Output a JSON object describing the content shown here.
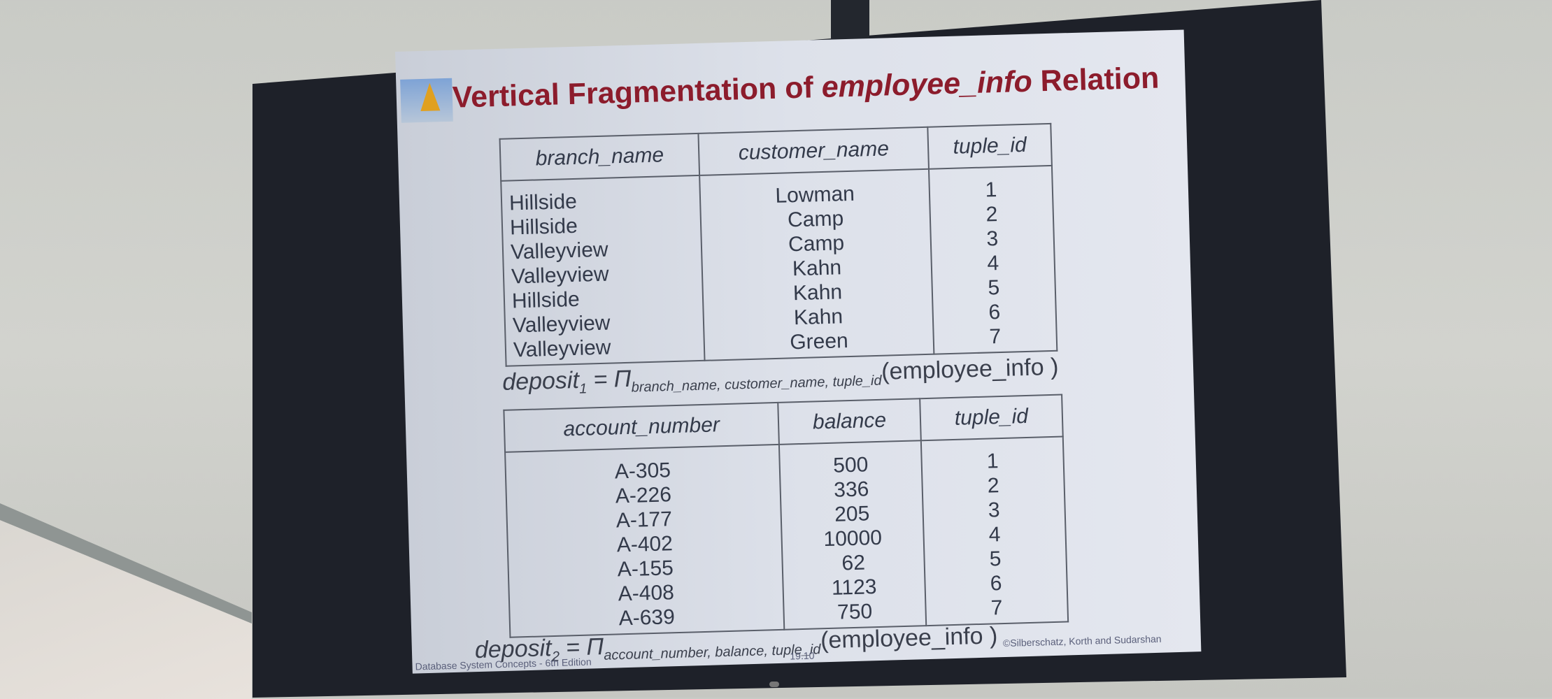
{
  "slide": {
    "title_prefix": "Vertical Fragmentation of ",
    "title_italic": "employee_info",
    "title_suffix": " Relation",
    "table1": {
      "headers": [
        "branch_name",
        "customer_name",
        "tuple_id"
      ],
      "rows": [
        [
          "Hillside",
          "Lowman",
          "1"
        ],
        [
          "Hillside",
          "Camp",
          "2"
        ],
        [
          "Valleyview",
          "Camp",
          "3"
        ],
        [
          "Valleyview",
          "Kahn",
          "4"
        ],
        [
          "Hillside",
          "Kahn",
          "5"
        ],
        [
          "Valleyview",
          "Kahn",
          "6"
        ],
        [
          "Valleyview",
          "Green",
          "7"
        ]
      ]
    },
    "formula1": {
      "lhs": "deposit",
      "sub_lhs": "1",
      "op": " = Π",
      "sub": "branch_name, customer_name, tuple_id",
      "arg": "(employee_info )"
    },
    "table2": {
      "headers": [
        "account_number",
        "balance",
        "tuple_id"
      ],
      "rows": [
        [
          "A-305",
          "500",
          "1"
        ],
        [
          "A-226",
          "336",
          "2"
        ],
        [
          "A-177",
          "205",
          "3"
        ],
        [
          "A-402",
          "10000",
          "4"
        ],
        [
          "A-155",
          "62",
          "5"
        ],
        [
          "A-408",
          "1123",
          "6"
        ],
        [
          "A-639",
          "750",
          "7"
        ]
      ]
    },
    "formula2": {
      "lhs": "deposit",
      "sub_lhs": "2",
      "op": " = Π",
      "sub": "account_number, balance, tuple_id",
      "arg": "(employee_info )"
    },
    "footer": {
      "left": "Database System Concepts - 6th Edition",
      "center": "19.10",
      "right": "©Silberschatz, Korth and Sudarshan"
    }
  }
}
